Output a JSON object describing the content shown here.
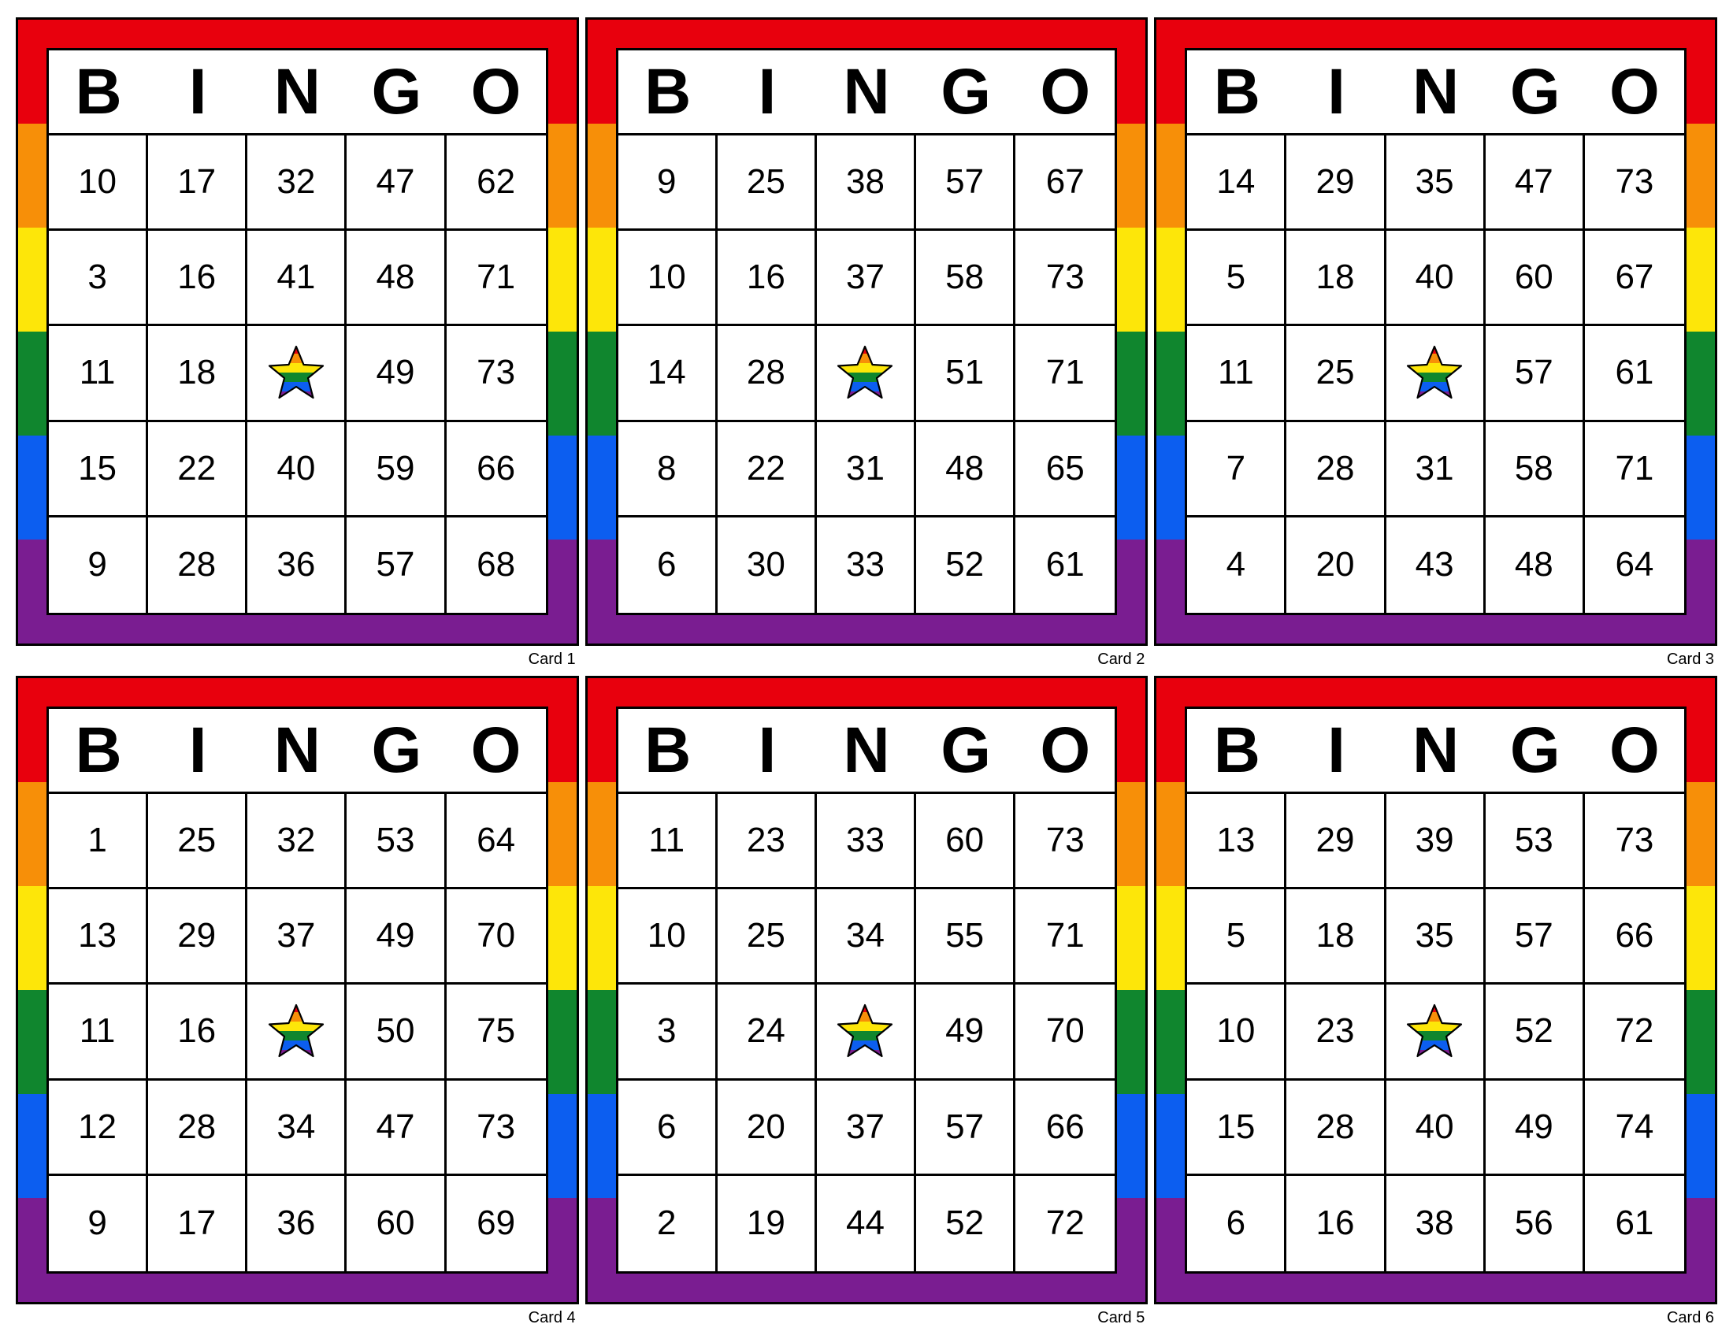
{
  "page": {
    "background": "#ffffff",
    "grid_layout": "3 columns x 2 rows"
  },
  "colors": {
    "red": "#e8000d",
    "orange": "#f78f08",
    "yellow": "#fde609",
    "green": "#10862e",
    "blue": "#0c5ef0",
    "purple": "#7a1d91",
    "border": "#000000",
    "cell_background": "#ffffff",
    "text": "#000000"
  },
  "header": {
    "letters": [
      "B",
      "I",
      "N",
      "G",
      "O"
    ]
  },
  "free_space": {
    "icon": "rainbow-star-icon",
    "stripes": [
      "#e8000d",
      "#f78f08",
      "#fde609",
      "#10862e",
      "#0c5ef0",
      "#7a1d91"
    ]
  },
  "cards": [
    {
      "label": "Card 1",
      "rows": [
        [
          "10",
          "17",
          "32",
          "47",
          "62"
        ],
        [
          "3",
          "16",
          "41",
          "48",
          "71"
        ],
        [
          "11",
          "18",
          "FREE",
          "49",
          "73"
        ],
        [
          "15",
          "22",
          "40",
          "59",
          "66"
        ],
        [
          "9",
          "28",
          "36",
          "57",
          "68"
        ]
      ]
    },
    {
      "label": "Card 2",
      "rows": [
        [
          "9",
          "25",
          "38",
          "57",
          "67"
        ],
        [
          "10",
          "16",
          "37",
          "58",
          "73"
        ],
        [
          "14",
          "28",
          "FREE",
          "51",
          "71"
        ],
        [
          "8",
          "22",
          "31",
          "48",
          "65"
        ],
        [
          "6",
          "30",
          "33",
          "52",
          "61"
        ]
      ]
    },
    {
      "label": "Card 3",
      "rows": [
        [
          "14",
          "29",
          "35",
          "47",
          "73"
        ],
        [
          "5",
          "18",
          "40",
          "60",
          "67"
        ],
        [
          "11",
          "25",
          "FREE",
          "57",
          "61"
        ],
        [
          "7",
          "28",
          "31",
          "58",
          "71"
        ],
        [
          "4",
          "20",
          "43",
          "48",
          "64"
        ]
      ]
    },
    {
      "label": "Card 4",
      "rows": [
        [
          "1",
          "25",
          "32",
          "53",
          "64"
        ],
        [
          "13",
          "29",
          "37",
          "49",
          "70"
        ],
        [
          "11",
          "16",
          "FREE",
          "50",
          "75"
        ],
        [
          "12",
          "28",
          "34",
          "47",
          "73"
        ],
        [
          "9",
          "17",
          "36",
          "60",
          "69"
        ]
      ]
    },
    {
      "label": "Card 5",
      "rows": [
        [
          "11",
          "23",
          "33",
          "60",
          "73"
        ],
        [
          "10",
          "25",
          "34",
          "55",
          "71"
        ],
        [
          "3",
          "24",
          "FREE",
          "49",
          "70"
        ],
        [
          "6",
          "20",
          "37",
          "57",
          "66"
        ],
        [
          "2",
          "19",
          "44",
          "52",
          "72"
        ]
      ]
    },
    {
      "label": "Card 6",
      "rows": [
        [
          "13",
          "29",
          "39",
          "53",
          "73"
        ],
        [
          "5",
          "18",
          "35",
          "57",
          "66"
        ],
        [
          "10",
          "23",
          "FREE",
          "52",
          "72"
        ],
        [
          "15",
          "28",
          "40",
          "49",
          "74"
        ],
        [
          "6",
          "16",
          "38",
          "56",
          "61"
        ]
      ]
    }
  ]
}
